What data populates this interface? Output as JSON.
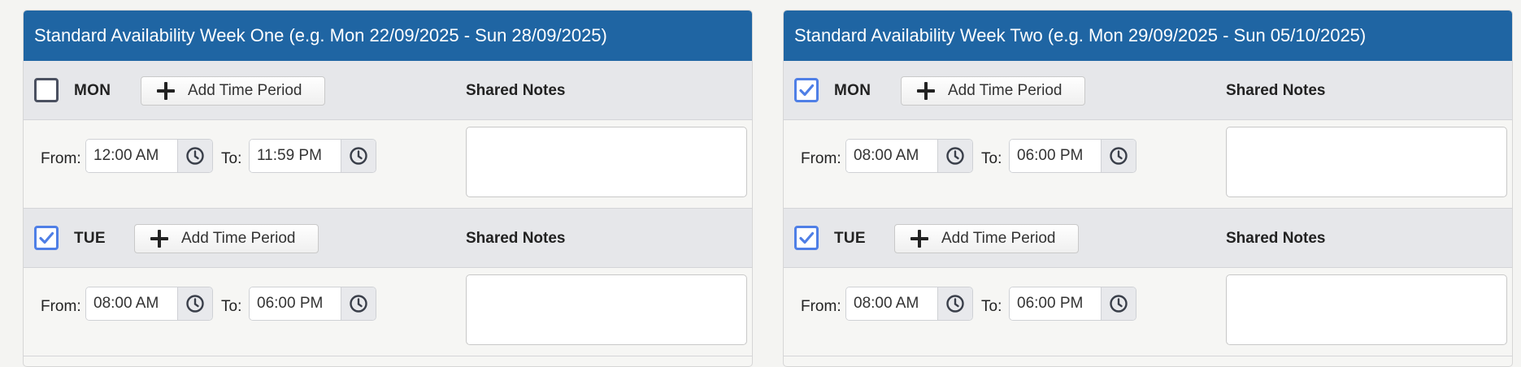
{
  "weeks": [
    {
      "title": "Standard Availability Week One (e.g. Mon 22/09/2025 - Sun 28/09/2025)",
      "days": [
        {
          "label": "MON",
          "checked": false,
          "add_label": "Add Time Period",
          "notes_label": "Shared Notes",
          "from_label": "From:",
          "from_value": "12:00 AM",
          "to_label": "To:",
          "to_value": "11:59 PM",
          "notes_value": ""
        },
        {
          "label": "TUE",
          "checked": true,
          "add_label": "Add Time Period",
          "notes_label": "Shared Notes",
          "from_label": "From:",
          "from_value": "08:00 AM",
          "to_label": "To:",
          "to_value": "06:00 PM",
          "notes_value": ""
        }
      ]
    },
    {
      "title": "Standard Availability Week Two (e.g. Mon 29/09/2025 - Sun 05/10/2025)",
      "days": [
        {
          "label": "MON",
          "checked": true,
          "add_label": "Add Time Period",
          "notes_label": "Shared Notes",
          "from_label": "From:",
          "from_value": "08:00 AM",
          "to_label": "To:",
          "to_value": "06:00 PM",
          "notes_value": ""
        },
        {
          "label": "TUE",
          "checked": true,
          "add_label": "Add Time Period",
          "notes_label": "Shared Notes",
          "from_label": "From:",
          "from_value": "08:00 AM",
          "to_label": "To:",
          "to_value": "06:00 PM",
          "notes_value": ""
        }
      ]
    }
  ],
  "icons": {
    "checkbox": "checkbox-icon",
    "add": "plus-icon",
    "time": "clock-icon"
  },
  "colors": {
    "header_bg": "#1f65a3",
    "checkbox_checked": "#4f7fe6",
    "checkbox_unchecked": "#4a5060"
  }
}
